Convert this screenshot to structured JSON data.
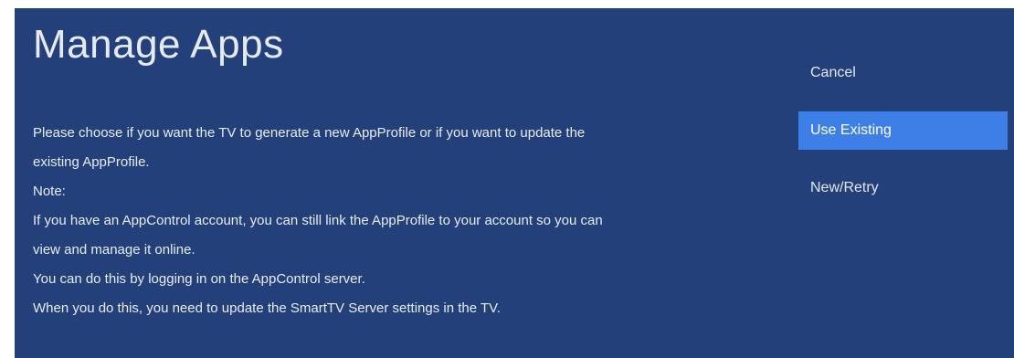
{
  "header": {
    "title": "Manage Apps"
  },
  "message": {
    "lines": [
      "Please choose if you want the TV to generate a new AppProfile or if you want to update the",
      "existing AppProfile.",
      "Note:",
      "If you have an AppControl account, you can still link the AppProfile to your account so you can",
      "view and manage it online.",
      "You can do this by logging in on the AppControl server.",
      "When you do this, you need to update the SmartTV Server settings in the TV."
    ]
  },
  "menu": {
    "selected": "Use Existing",
    "items": [
      {
        "label": "Cancel"
      },
      {
        "label": "Use Existing"
      },
      {
        "label": "New/Retry"
      }
    ]
  },
  "colors": {
    "background": "#24407a",
    "highlight": "#3d7fe6",
    "text": "#e4e9f2"
  }
}
